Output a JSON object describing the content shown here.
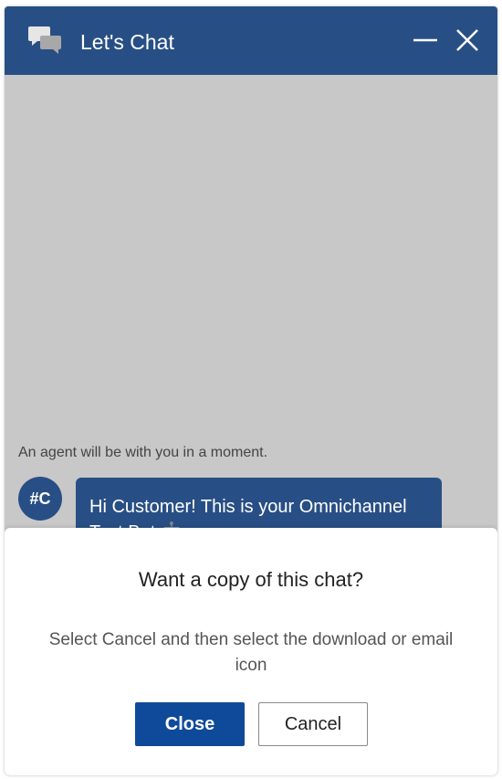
{
  "header": {
    "title": "Let's Chat",
    "chat_icon": "chat-bubbles-icon",
    "minimize_icon": "minimize-icon",
    "close_icon": "close-icon"
  },
  "conversation": {
    "system_message": "An agent will be with you in a moment.",
    "avatar_initials": "#C",
    "bot_message": "Hi Customer! This is your Omnichannel Test Bot 🤖"
  },
  "dialog": {
    "title": "Want a copy of this chat?",
    "body": "Select Cancel and then select the download or email icon",
    "close_label": "Close",
    "cancel_label": "Cancel"
  },
  "colors": {
    "header_bg": "#284f85",
    "body_bg": "#c8c8c8",
    "primary_button": "#0f4a9a"
  }
}
